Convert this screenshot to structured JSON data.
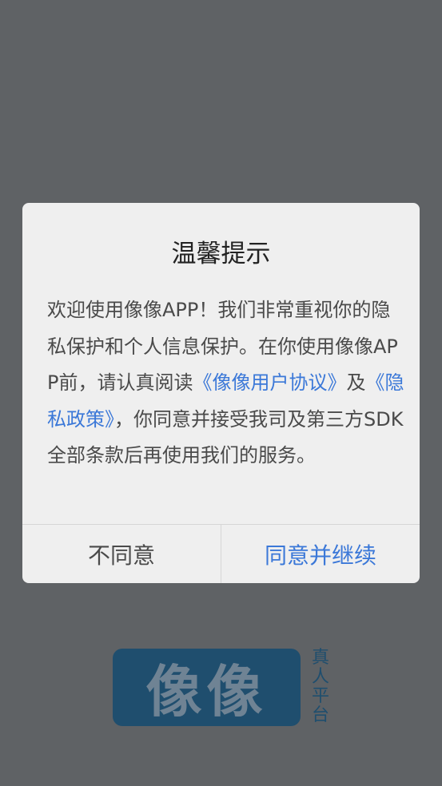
{
  "dialog": {
    "title": "温馨提示",
    "body_part1": "欢迎使用像像APP！我们非常重视你的隐私保护和个人信息保护。在你使用像像APP前，请认真阅读",
    "link_user_agreement": "《像像用户协议》",
    "body_and": "及",
    "link_privacy_policy": "《隐私政策》",
    "body_part2": "，你同意并接受我司及第三方SDK全部条款后再使用我们的服务。",
    "decline_label": "不同意",
    "agree_label": "同意并继续"
  },
  "logo": {
    "text": "像像",
    "side_text_1": "真",
    "side_text_2": "人",
    "side_text_3": "平",
    "side_text_4": "台"
  },
  "colors": {
    "background": "#5f6265",
    "dialog": "#efefef",
    "link": "#3b78d8",
    "logo": "#1f4e6e"
  }
}
